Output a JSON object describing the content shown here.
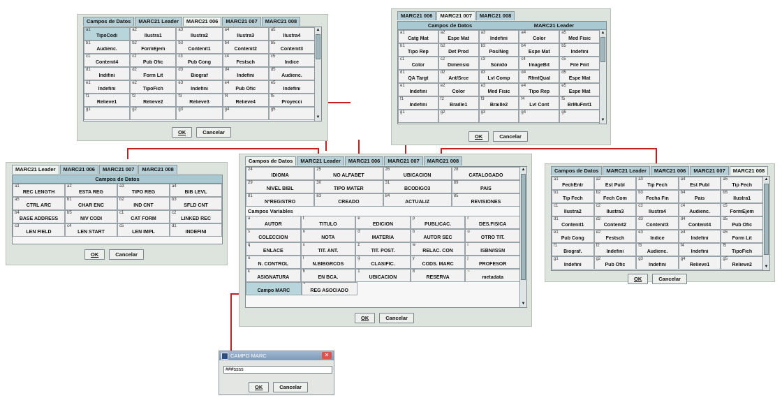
{
  "p1": {
    "tabs": [
      "Campos de Datos",
      "MARC21 Leader",
      "MARC21 006",
      "MARC21 007",
      "MARC21 008"
    ],
    "active": 2,
    "rows": [
      [
        [
          "a1",
          "TipoCodi"
        ],
        [
          "a2",
          "Ilustra1"
        ],
        [
          "a3",
          "Ilustra2"
        ],
        [
          "a4",
          "Ilustra3"
        ],
        [
          "a5",
          "Ilustra4"
        ]
      ],
      [
        [
          "b1",
          "Audienc."
        ],
        [
          "b2",
          "FormEjem"
        ],
        [
          "b3",
          "Contenit1"
        ],
        [
          "b4",
          "Contenit2"
        ],
        [
          "b5",
          "Contenit3"
        ]
      ],
      [
        [
          "c1",
          "Contenit4"
        ],
        [
          "c2",
          "Pub Ofic"
        ],
        [
          "c3",
          "Pub Cong"
        ],
        [
          "c4",
          "Festsch"
        ],
        [
          "c5",
          "Indice"
        ]
      ],
      [
        [
          "d1",
          "Indifini"
        ],
        [
          "d2",
          "Form Lit"
        ],
        [
          "d3",
          "Biograf"
        ],
        [
          "d4",
          "Indefini"
        ],
        [
          "d5",
          "Audienc."
        ]
      ],
      [
        [
          "e1",
          "Indefini"
        ],
        [
          "e2",
          "TipoFich"
        ],
        [
          "e3",
          "Indefini"
        ],
        [
          "e4",
          "Pub Ofic"
        ],
        [
          "e5",
          "Indefini"
        ]
      ],
      [
        [
          "f1",
          "Relieve1"
        ],
        [
          "f2",
          "Relieve2"
        ],
        [
          "f3",
          "Relieve3"
        ],
        [
          "f4",
          "Relieve4"
        ],
        [
          "f5",
          "Proyecci"
        ]
      ],
      [
        [
          "g1",
          ""
        ],
        [
          "g2",
          ""
        ],
        [
          "g3",
          ""
        ],
        [
          "g4",
          ""
        ],
        [
          "g5",
          ""
        ]
      ]
    ],
    "ok": "OK",
    "cancel": "Cancelar"
  },
  "p2": {
    "tabs": [
      "MARC21 006",
      "MARC21 007",
      "MARC21 008"
    ],
    "active": 1,
    "headers": [
      "Campos de Datos",
      "MARC21 Leader"
    ],
    "rows": [
      [
        [
          "a1",
          "Catg Mat"
        ],
        [
          "a2",
          "Espe Mat"
        ],
        [
          "a3",
          "Indefini"
        ],
        [
          "a4",
          "Color"
        ],
        [
          "a5",
          "Med Fisic"
        ]
      ],
      [
        [
          "b1",
          "Tipo Rep"
        ],
        [
          "b2",
          "Det Prod"
        ],
        [
          "b3",
          "Pos/Neg"
        ],
        [
          "b4",
          "Espe Mat"
        ],
        [
          "b5",
          "Indefini"
        ]
      ],
      [
        [
          "c1",
          "Color"
        ],
        [
          "c2",
          "Dimensio"
        ],
        [
          "c3",
          "Sonido"
        ],
        [
          "c4",
          "ImageBit"
        ],
        [
          "c5",
          "File Fmt"
        ]
      ],
      [
        [
          "d1",
          "QA Targt"
        ],
        [
          "d2",
          "Ant/Srce"
        ],
        [
          "d3",
          "Lvl Comp"
        ],
        [
          "d4",
          "RfmtQual"
        ],
        [
          "d5",
          "Espe Mat"
        ]
      ],
      [
        [
          "e1",
          "Indefini"
        ],
        [
          "e2",
          "Color"
        ],
        [
          "e3",
          "Med Fisic"
        ],
        [
          "e4",
          "Tipo Rep"
        ],
        [
          "e5",
          "Espe Mat"
        ]
      ],
      [
        [
          "f1",
          "Indefini"
        ],
        [
          "f2",
          "Braille1"
        ],
        [
          "f3",
          "Braille2"
        ],
        [
          "f4",
          "Lvl Cont"
        ],
        [
          "f5",
          "BrMuFmt1"
        ]
      ],
      [
        [
          "g1",
          ""
        ],
        [
          "g2",
          ""
        ],
        [
          "g3",
          ""
        ],
        [
          "g4",
          ""
        ],
        [
          "g5",
          ""
        ]
      ]
    ],
    "ok": "OK",
    "cancel": "Cancelar"
  },
  "p3": {
    "tabs": [
      "MARC21 Leader",
      "MARC21 006",
      "MARC21 007",
      "MARC21 008"
    ],
    "active": 0,
    "header": "Campos de Datos",
    "rows": [
      [
        [
          "a1",
          "REC LENGTH"
        ],
        [
          "a2",
          "ESTA REG"
        ],
        [
          "a3",
          "TIPO REG"
        ],
        [
          "a4",
          "BIB LEVL"
        ]
      ],
      [
        [
          "a5",
          "CTRL ARC"
        ],
        [
          "b1",
          "CHAR ENC"
        ],
        [
          "b2",
          "IND CNT"
        ],
        [
          "b3",
          "SFLD CNT"
        ]
      ],
      [
        [
          "b4",
          "BASE ADDRESS"
        ],
        [
          "b5",
          "NIV CODI"
        ],
        [
          "c1",
          "CAT FORM"
        ],
        [
          "c2",
          "LINKED REC"
        ]
      ],
      [
        [
          "c3",
          "LEN FIELD"
        ],
        [
          "c4",
          "LEN START"
        ],
        [
          "c5",
          "LEN IMPL"
        ],
        [
          "d1",
          "INDEFINI"
        ]
      ]
    ],
    "ok": "OK",
    "cancel": "Cancelar"
  },
  "p4": {
    "tabs": [
      "Campos de Datos",
      "MARC21 Leader",
      "MARC21 006",
      "MARC21 007",
      "MARC21 008"
    ],
    "active": 0,
    "fixed": [
      [
        [
          "24",
          "IDIOMA"
        ],
        [
          "25",
          "NO ALFABET"
        ],
        [
          "26",
          "UBICACION"
        ],
        [
          "28",
          "CATALOGADO"
        ]
      ],
      [
        [
          "29",
          "NIVEL BIBL"
        ],
        [
          "30",
          "TIPO MATER"
        ],
        [
          "31",
          "BCODIGO3"
        ],
        [
          "89",
          "PAIS"
        ]
      ],
      [
        [
          "81",
          "NºREGISTRO"
        ],
        [
          "83",
          "CREADO"
        ],
        [
          "84",
          "ACTUALIZ"
        ],
        [
          "85",
          "REVISIONES"
        ]
      ]
    ],
    "section": "Campos Variables",
    "vars": [
      [
        [
          "a",
          "AUTOR"
        ],
        [
          "t",
          "TÍTULO"
        ],
        [
          "e",
          "EDICIÓN"
        ],
        [
          "p",
          "PUBLICAC."
        ],
        [
          "r",
          "DES.FÍSICA"
        ]
      ],
      [
        [
          "s",
          "COLECCION"
        ],
        [
          "n",
          "NOTA"
        ],
        [
          "d",
          "MATERIA"
        ],
        [
          "b",
          "AUTOR SEC"
        ],
        [
          "u",
          "OTRO TÍT."
        ]
      ],
      [
        [
          "q",
          "ENLACE"
        ],
        [
          "x",
          "TIT. ANT."
        ],
        [
          "z",
          "TIT. POST."
        ],
        [
          "w",
          "RELAC. CON"
        ],
        [
          "i",
          "ISBN/ISSN"
        ]
      ],
      [
        [
          "o",
          "N. CONTROL"
        ],
        [
          "l",
          "N.BIBGRCOS"
        ],
        [
          "g",
          "CLASIFIC."
        ],
        [
          "y",
          "CODS. MARC"
        ],
        [
          "j",
          "PROFESOR"
        ]
      ],
      [
        [
          "k",
          "ASIGNATURA"
        ],
        [
          "h",
          "EN BCA."
        ],
        [
          "1",
          "UBICACION"
        ],
        [
          "8",
          "RESERVA"
        ],
        [
          "~",
          "metadata"
        ]
      ],
      [
        [
          "",
          "Campo MARC"
        ],
        [
          "*",
          "REG ASOCIADO"
        ]
      ]
    ],
    "ok": "OK",
    "cancel": "Cancelar"
  },
  "p5": {
    "tabs": [
      "Campos de Datos",
      "MARC21 Leader",
      "MARC21 006",
      "MARC21 007",
      "MARC21 008"
    ],
    "active": 4,
    "rows": [
      [
        [
          "a1",
          "FechEntr"
        ],
        [
          "a2",
          "Est Publ"
        ],
        [
          "a3",
          "Tip Fech"
        ],
        [
          "a4",
          "Est Publ"
        ],
        [
          "a5",
          "Tip Fech"
        ]
      ],
      [
        [
          "b1",
          "Tip Fech"
        ],
        [
          "b2",
          "Fech Com"
        ],
        [
          "b3",
          "Fecha Fin"
        ],
        [
          "b4",
          "Pais"
        ],
        [
          "b5",
          "Ilustra1"
        ]
      ],
      [
        [
          "c1",
          "Ilustra2"
        ],
        [
          "c2",
          "Ilustra3"
        ],
        [
          "c3",
          "Ilustra4"
        ],
        [
          "c4",
          "Audienc."
        ],
        [
          "c5",
          "FormEjem"
        ]
      ],
      [
        [
          "d1",
          "Contenit1"
        ],
        [
          "d2",
          "Contenit2"
        ],
        [
          "d3",
          "Contenit3"
        ],
        [
          "d4",
          "Contenit4"
        ],
        [
          "d5",
          "Pub Ofic"
        ]
      ],
      [
        [
          "e1",
          "Pub Cong"
        ],
        [
          "e2",
          "Festsch"
        ],
        [
          "e3",
          "Indice"
        ],
        [
          "e4",
          "Indefini"
        ],
        [
          "e5",
          "Form Lit"
        ]
      ],
      [
        [
          "f1",
          "Biograf."
        ],
        [
          "f2",
          "Indefini"
        ],
        [
          "f3",
          "Audienc."
        ],
        [
          "f4",
          "Indefini"
        ],
        [
          "f5",
          "TipoFich"
        ]
      ],
      [
        [
          "g1",
          "Indefini"
        ],
        [
          "g2",
          "Pub Ofic"
        ],
        [
          "g3",
          "Indefini"
        ],
        [
          "g4",
          "Relieve1"
        ],
        [
          "g5",
          "Relieve2"
        ]
      ]
    ],
    "ok": "OK",
    "cancel": "Cancelar"
  },
  "dlg": {
    "title": "CAMPO MARC",
    "value": "###ssss",
    "ok": "OK",
    "cancel": "Cancelar"
  }
}
